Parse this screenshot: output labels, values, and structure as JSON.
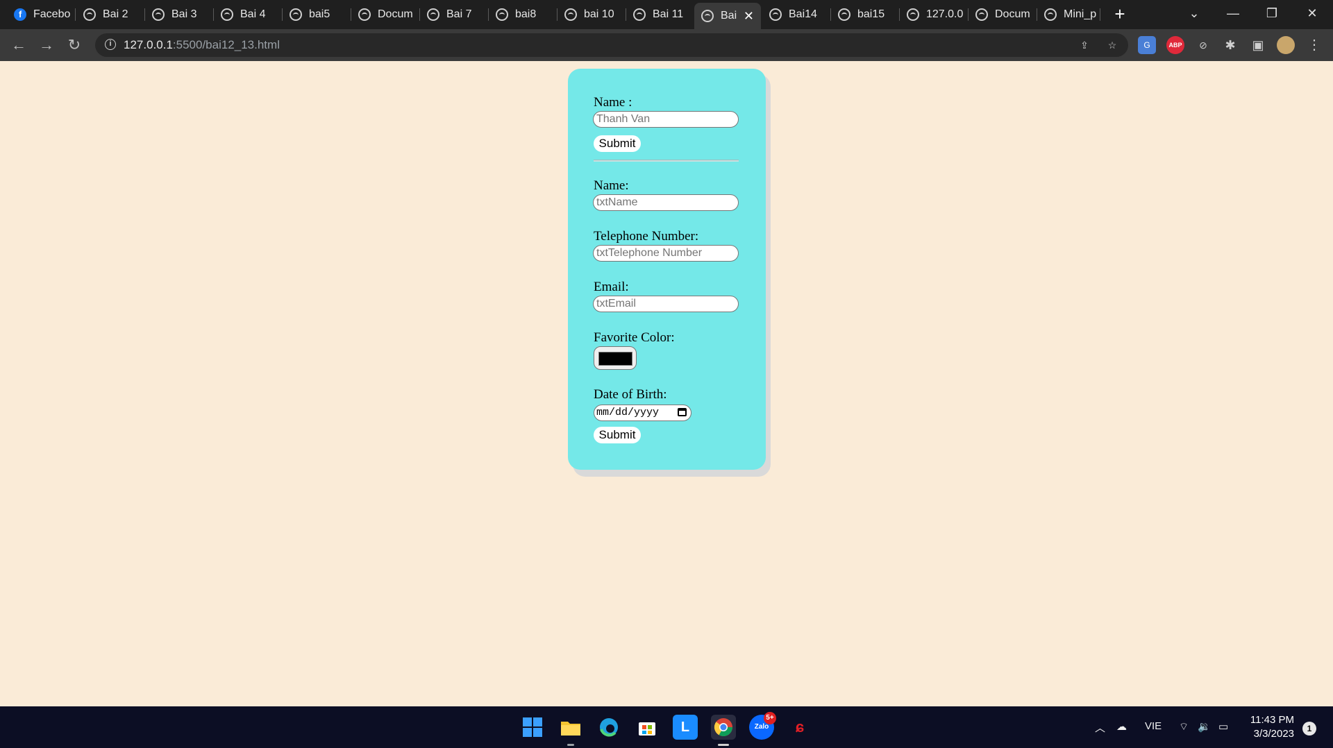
{
  "browser": {
    "tabs": [
      {
        "label": "Facebo",
        "icon": "facebook-icon"
      },
      {
        "label": "Bai 2",
        "icon": "globe-icon"
      },
      {
        "label": "Bai 3",
        "icon": "globe-icon"
      },
      {
        "label": "Bai 4",
        "icon": "globe-icon"
      },
      {
        "label": "bai5",
        "icon": "globe-icon"
      },
      {
        "label": "Docum",
        "icon": "globe-icon"
      },
      {
        "label": "Bai 7",
        "icon": "globe-icon"
      },
      {
        "label": "bai8",
        "icon": "globe-icon"
      },
      {
        "label": "bai 10",
        "icon": "globe-icon"
      },
      {
        "label": "Bai 11",
        "icon": "globe-icon"
      },
      {
        "label": "Bai",
        "icon": "globe-icon",
        "active": true
      },
      {
        "label": "Bai14",
        "icon": "globe-icon"
      },
      {
        "label": "bai15",
        "icon": "globe-icon"
      },
      {
        "label": "127.0.0",
        "icon": "globe-icon"
      },
      {
        "label": "Docum",
        "icon": "globe-icon"
      },
      {
        "label": "Mini_p",
        "icon": "globe-icon"
      }
    ],
    "url_host": "127.0.0.1",
    "url_path": ":5500/bai12_13.html",
    "extensions": [
      "translate-icon",
      "adblock-icon",
      "compass-icon",
      "puzzle-icon",
      "sidepanel-icon",
      "profile-avatar",
      "menu-icon"
    ],
    "abp_label": "ABP"
  },
  "form1": {
    "name_label": "Name :",
    "name_placeholder": "Thanh Van",
    "submit_label": "Submit"
  },
  "form2": {
    "name_label": "Name:",
    "name_placeholder": "txtName",
    "phone_label": "Telephone Number:",
    "phone_placeholder": "txtTelephone Number",
    "email_label": "Email:",
    "email_placeholder": "txtEmail",
    "color_label": "Favorite Color:",
    "color_value": "#000000",
    "dob_label": "Date of Birth:",
    "dob_placeholder": "mm/dd/yyyy",
    "submit_label": "Submit"
  },
  "taskbar": {
    "apps": [
      "windows-start-icon",
      "file-explorer-icon",
      "edge-icon",
      "store-icon",
      "l-app-icon",
      "chrome-icon",
      "zalo-icon",
      "garena-icon"
    ],
    "zalo_badge": "5+",
    "l_app_label": "L",
    "language": "VIE",
    "time": "11:43 PM",
    "date": "3/3/2023",
    "notification_count": "1"
  },
  "colors": {
    "page_bg": "#faebd7",
    "card_bg": "#74e8e8",
    "tabbar_bg": "#1f1f1f",
    "toolbar_bg": "#3a3a3a",
    "taskbar_bg": "#0c0e24"
  }
}
